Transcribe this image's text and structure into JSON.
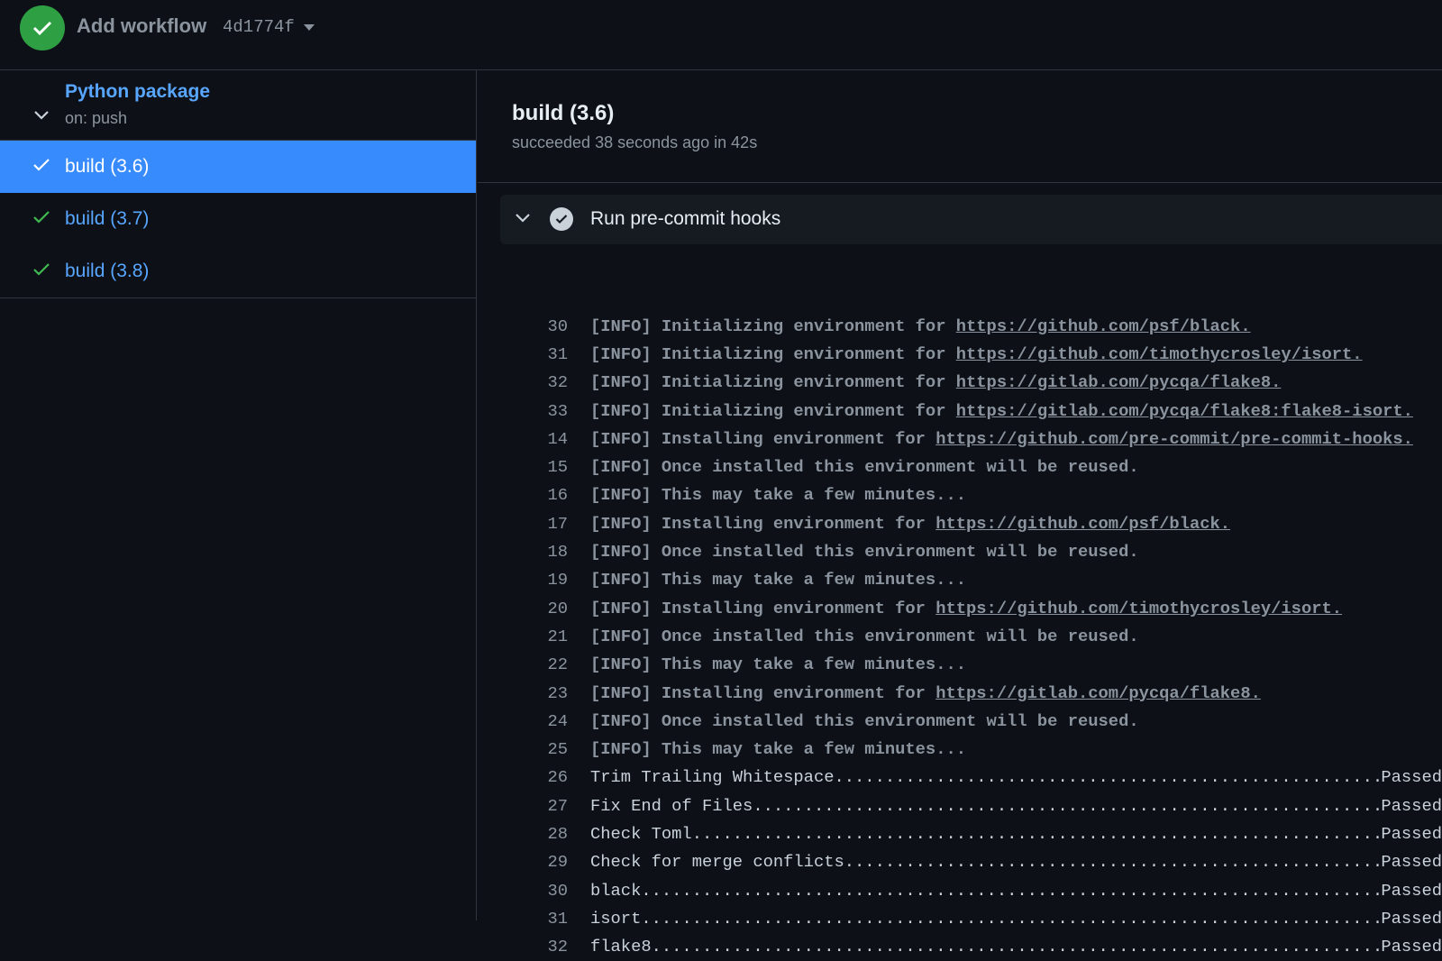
{
  "header": {
    "title": "Add workflow",
    "commit": "4d1774f"
  },
  "sidebar": {
    "workflow_name": "Python package",
    "trigger": "on: push",
    "jobs": [
      {
        "label": "build (3.6)"
      },
      {
        "label": "build (3.7)"
      },
      {
        "label": "build (3.8)"
      }
    ]
  },
  "job": {
    "title": "build (3.6)",
    "status": "succeeded 38 seconds ago in 42s"
  },
  "step": {
    "name": "Run pre-commit hooks"
  },
  "log": [
    {
      "n": "30",
      "text": "[INFO] Initializing environment for ",
      "link": "https://github.com/psf/black."
    },
    {
      "n": "31",
      "text": "[INFO] Initializing environment for ",
      "link": "https://github.com/timothycrosley/isort."
    },
    {
      "n": "32",
      "text": "[INFO] Initializing environment for ",
      "link": "https://gitlab.com/pycqa/flake8."
    },
    {
      "n": "33",
      "text": "[INFO] Initializing environment for ",
      "link": "https://gitlab.com/pycqa/flake8:flake8-isort."
    },
    {
      "n": "14",
      "text": "[INFO] Installing environment for ",
      "link": "https://github.com/pre-commit/pre-commit-hooks."
    },
    {
      "n": "15",
      "text": "[INFO] Once installed this environment will be reused."
    },
    {
      "n": "16",
      "text": "[INFO] This may take a few minutes..."
    },
    {
      "n": "17",
      "text": "[INFO] Installing environment for ",
      "link": "https://github.com/psf/black."
    },
    {
      "n": "18",
      "text": "[INFO] Once installed this environment will be reused."
    },
    {
      "n": "19",
      "text": "[INFO] This may take a few minutes..."
    },
    {
      "n": "20",
      "text": "[INFO] Installing environment for ",
      "link": "https://github.com/timothycrosley/isort."
    },
    {
      "n": "21",
      "text": "[INFO] Once installed this environment will be reused."
    },
    {
      "n": "22",
      "text": "[INFO] This may take a few minutes..."
    },
    {
      "n": "23",
      "text": "[INFO] Installing environment for ",
      "link": "https://gitlab.com/pycqa/flake8."
    },
    {
      "n": "24",
      "text": "[INFO] Once installed this environment will be reused."
    },
    {
      "n": "25",
      "text": "[INFO] This may take a few minutes..."
    },
    {
      "n": "26",
      "text": "Trim Trailing Whitespace",
      "result": "Passed"
    },
    {
      "n": "27",
      "text": "Fix End of Files",
      "result": "Passed"
    },
    {
      "n": "28",
      "text": "Check Toml",
      "result": "Passed"
    },
    {
      "n": "29",
      "text": "Check for merge conflicts",
      "result": "Passed"
    },
    {
      "n": "30",
      "text": "black",
      "result": "Passed"
    },
    {
      "n": "31",
      "text": "isort",
      "result": "Passed"
    },
    {
      "n": "32",
      "text": "flake8",
      "result": "Passed"
    }
  ]
}
